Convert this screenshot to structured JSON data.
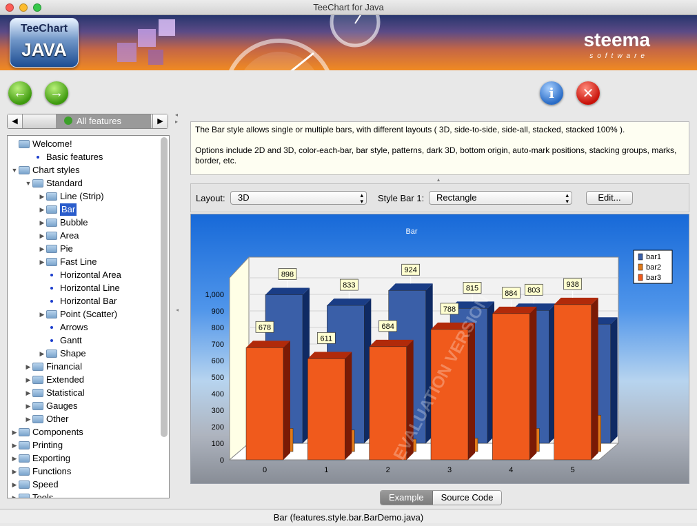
{
  "window": {
    "title": "TeeChart for Java"
  },
  "banner": {
    "logo_top": "TeeChart",
    "logo_bottom": "JAVA",
    "brand": "steema",
    "brand_sub": "software"
  },
  "nav": {
    "back_glyph": "←",
    "forward_glyph": "→",
    "info_glyph": "i",
    "close_glyph": "✕"
  },
  "feature_combo": {
    "label": "All features",
    "left_glyph": "◀",
    "right_glyph": "▶"
  },
  "tree": {
    "items": [
      {
        "label": "Welcome!",
        "type": "folder",
        "level": 0,
        "expander": ""
      },
      {
        "label": "Basic features",
        "type": "leaf",
        "level": 1,
        "expander": ""
      },
      {
        "label": "Chart styles",
        "type": "folder",
        "level": 0,
        "expander": "open"
      },
      {
        "label": "Standard",
        "type": "folder",
        "level": 1,
        "expander": "open"
      },
      {
        "label": "Line (Strip)",
        "type": "folder",
        "level": 2,
        "expander": "closed"
      },
      {
        "label": "Bar",
        "type": "folder",
        "level": 2,
        "expander": "closed",
        "selected": true
      },
      {
        "label": "Bubble",
        "type": "folder",
        "level": 2,
        "expander": "closed"
      },
      {
        "label": "Area",
        "type": "folder",
        "level": 2,
        "expander": "closed"
      },
      {
        "label": "Pie",
        "type": "folder",
        "level": 2,
        "expander": "closed"
      },
      {
        "label": "Fast Line",
        "type": "folder",
        "level": 2,
        "expander": "closed"
      },
      {
        "label": "Horizontal Area",
        "type": "leaf",
        "level": 2,
        "expander": ""
      },
      {
        "label": "Horizontal Line",
        "type": "leaf",
        "level": 2,
        "expander": ""
      },
      {
        "label": "Horizontal Bar",
        "type": "leaf",
        "level": 2,
        "expander": ""
      },
      {
        "label": "Point (Scatter)",
        "type": "folder",
        "level": 2,
        "expander": "closed"
      },
      {
        "label": "Arrows",
        "type": "leaf",
        "level": 2,
        "expander": ""
      },
      {
        "label": "Gantt",
        "type": "leaf",
        "level": 2,
        "expander": ""
      },
      {
        "label": "Shape",
        "type": "folder",
        "level": 2,
        "expander": "closed"
      },
      {
        "label": "Financial",
        "type": "folder",
        "level": 1,
        "expander": "closed"
      },
      {
        "label": "Extended",
        "type": "folder",
        "level": 1,
        "expander": "closed"
      },
      {
        "label": "Statistical",
        "type": "folder",
        "level": 1,
        "expander": "closed"
      },
      {
        "label": "Gauges",
        "type": "folder",
        "level": 1,
        "expander": "closed"
      },
      {
        "label": "Other",
        "type": "folder",
        "level": 1,
        "expander": "closed"
      },
      {
        "label": "Components",
        "type": "folder",
        "level": 0,
        "expander": "closed"
      },
      {
        "label": "Printing",
        "type": "folder",
        "level": 0,
        "expander": "closed"
      },
      {
        "label": "Exporting",
        "type": "folder",
        "level": 0,
        "expander": "closed"
      },
      {
        "label": "Functions",
        "type": "folder",
        "level": 0,
        "expander": "closed"
      },
      {
        "label": "Speed",
        "type": "folder",
        "level": 0,
        "expander": "closed"
      },
      {
        "label": "Tools",
        "type": "folder",
        "level": 0,
        "expander": "closed"
      }
    ]
  },
  "description": {
    "line1": "The Bar style allows single or multiple bars, with different layouts ( 3D, side-to-side, side-all, stacked, stacked 100% ).",
    "line2": "Options include 2D and 3D, color-each-bar, bar style, patterns, dark 3D, bottom origin, auto-mark positions, stacking groups, marks, border, etc."
  },
  "toolbar": {
    "layout_label": "Layout:",
    "layout_value": "3D",
    "style_label": "Style Bar 1:",
    "style_value": "Rectangle",
    "edit_label": "Edit..."
  },
  "chart_data": {
    "type": "bar",
    "title": "Bar",
    "categories": [
      "0",
      "1",
      "2",
      "3",
      "4",
      "5"
    ],
    "series": [
      {
        "name": "bar1",
        "color": "#3a5fa8",
        "values": [
          898,
          833,
          924,
          815,
          803,
          720
        ]
      },
      {
        "name": "bar2",
        "color": "#e07a1a",
        "values": [
          140,
          130,
          75,
          80,
          140,
          220
        ]
      },
      {
        "name": "bar3",
        "color": "#f05a1c",
        "values": [
          678,
          611,
          684,
          788,
          884,
          938
        ]
      }
    ],
    "yticks": [
      "0",
      "100",
      "200",
      "300",
      "400",
      "500",
      "600",
      "700",
      "800",
      "900",
      "1,000"
    ],
    "ylim": [
      0,
      1100
    ],
    "watermark": "EVALUATION VERSION",
    "legend": "right"
  },
  "tabs": {
    "example": "Example",
    "source": "Source Code"
  },
  "status": {
    "text": "Bar  (features.style.bar.BarDemo.java)"
  }
}
